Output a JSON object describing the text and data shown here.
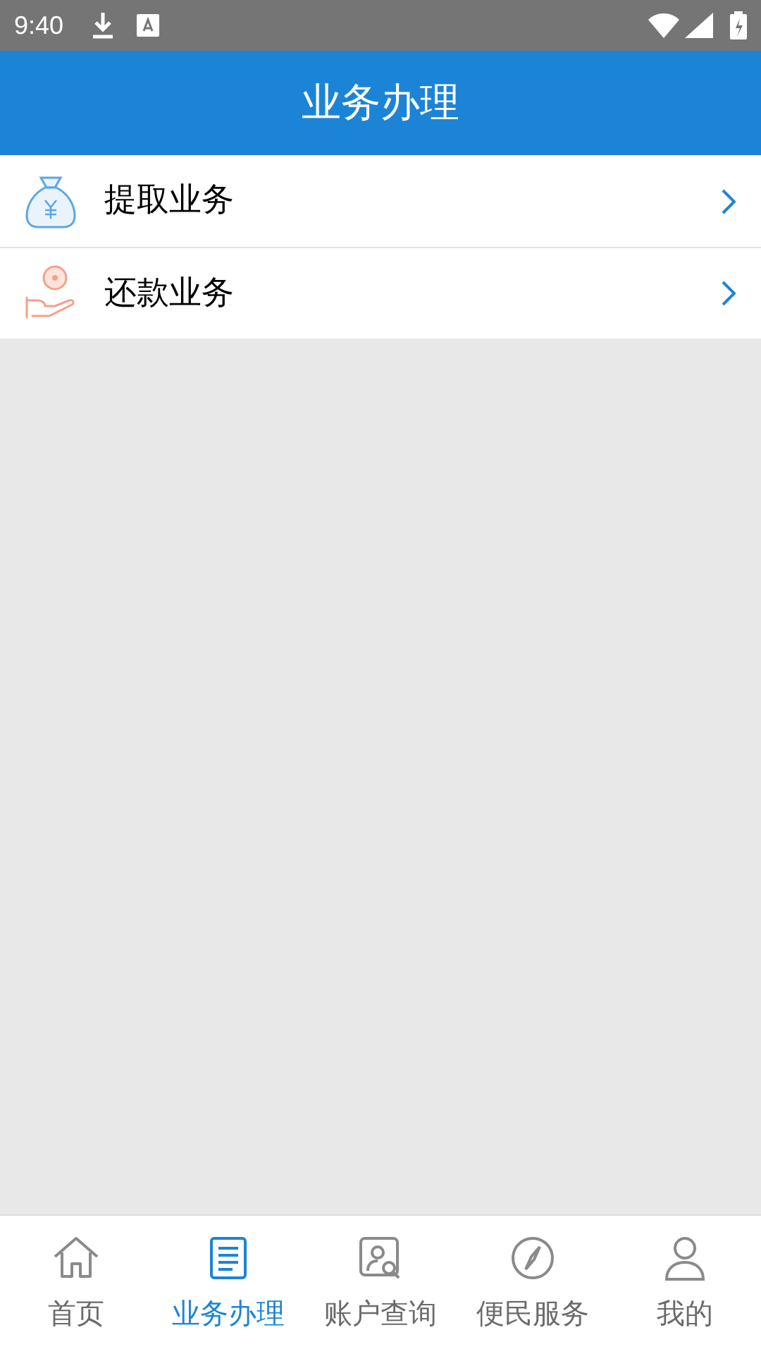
{
  "status_bar": {
    "time": "9:40"
  },
  "header": {
    "title": "业务办理"
  },
  "items": [
    {
      "label": "提取业务",
      "kind": "withdraw"
    },
    {
      "label": "还款业务",
      "kind": "repay"
    }
  ],
  "tabs": [
    {
      "label": "首页",
      "kind": "home",
      "selected": false
    },
    {
      "label": "业务办理",
      "kind": "doc",
      "selected": true
    },
    {
      "label": "账户查询",
      "kind": "query",
      "selected": false
    },
    {
      "label": "便民服务",
      "kind": "compass",
      "selected": false
    },
    {
      "label": "我的",
      "kind": "user",
      "selected": false
    }
  ]
}
